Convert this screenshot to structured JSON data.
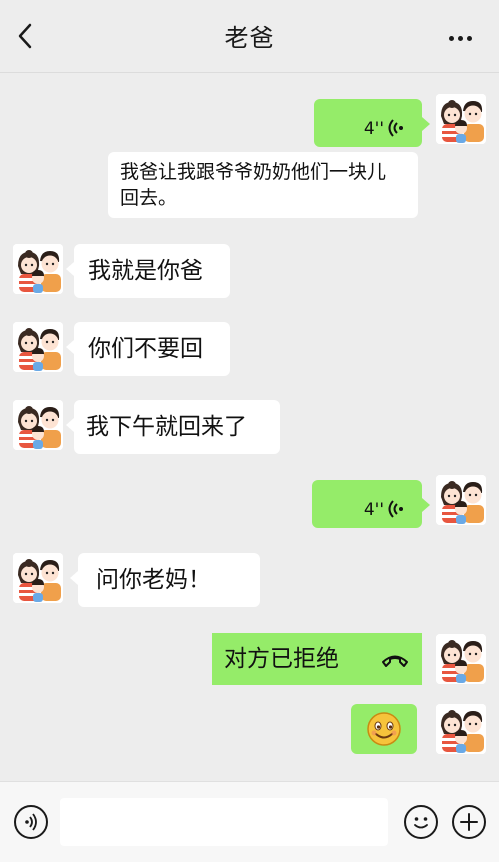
{
  "header": {
    "title": "老爸",
    "back_icon": "chevron-left-icon",
    "more_icon": "more-dots-icon"
  },
  "messages": [
    {
      "side": "right",
      "type": "voice",
      "duration": "4''"
    },
    {
      "side": "right",
      "type": "text",
      "text_line1": "我爸让我跟爷爷奶奶他们一块儿",
      "text_line2": "回去。"
    },
    {
      "side": "left",
      "type": "text",
      "text": "我就是你爸"
    },
    {
      "side": "left",
      "type": "text",
      "text": "你们不要回"
    },
    {
      "side": "left",
      "type": "text",
      "text": "我下午就回来了"
    },
    {
      "side": "right",
      "type": "voice",
      "duration": "4''"
    },
    {
      "side": "left",
      "type": "text",
      "text": "问你老妈！"
    },
    {
      "side": "right",
      "type": "call",
      "text": "对方已拒绝",
      "icon": "hangup-phone-icon"
    },
    {
      "side": "right",
      "type": "emoji",
      "icon": "smile-emoji-icon"
    }
  ],
  "colors": {
    "background": "#ededed",
    "sent_bubble": "#95ec69",
    "received_bubble": "#ffffff"
  },
  "footer": {
    "voice_icon": "voice-input-icon",
    "emoji_icon": "emoji-icon",
    "plus_icon": "plus-icon"
  }
}
